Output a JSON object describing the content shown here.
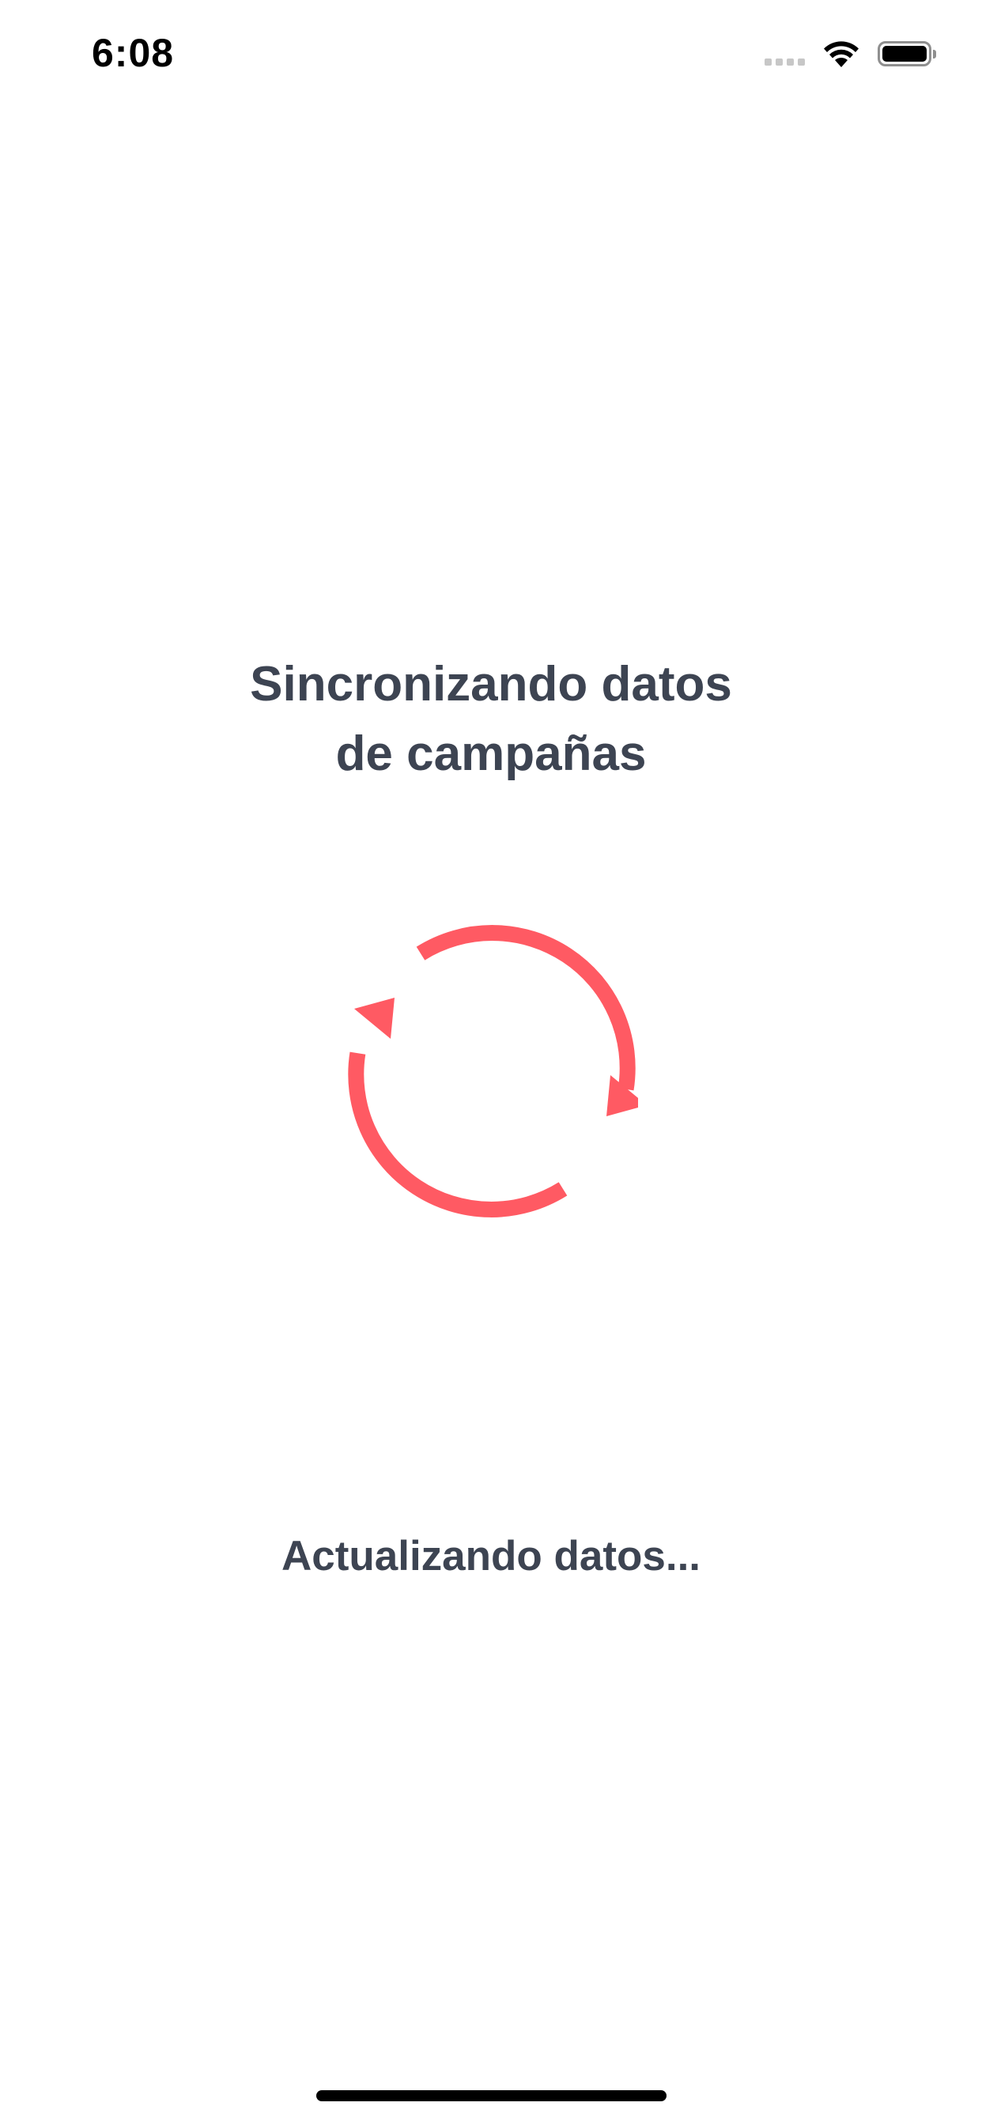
{
  "status_bar": {
    "time": "6:08",
    "battery_level": 1.0
  },
  "sync_screen": {
    "title_line1": "Sincronizando datos",
    "title_line2": "de campañas",
    "icon": "sync-icon",
    "message": "Actualizando datos..."
  },
  "colors": {
    "accent": "#ff5a63",
    "text": "#3d4452",
    "background": "#ffffff"
  }
}
